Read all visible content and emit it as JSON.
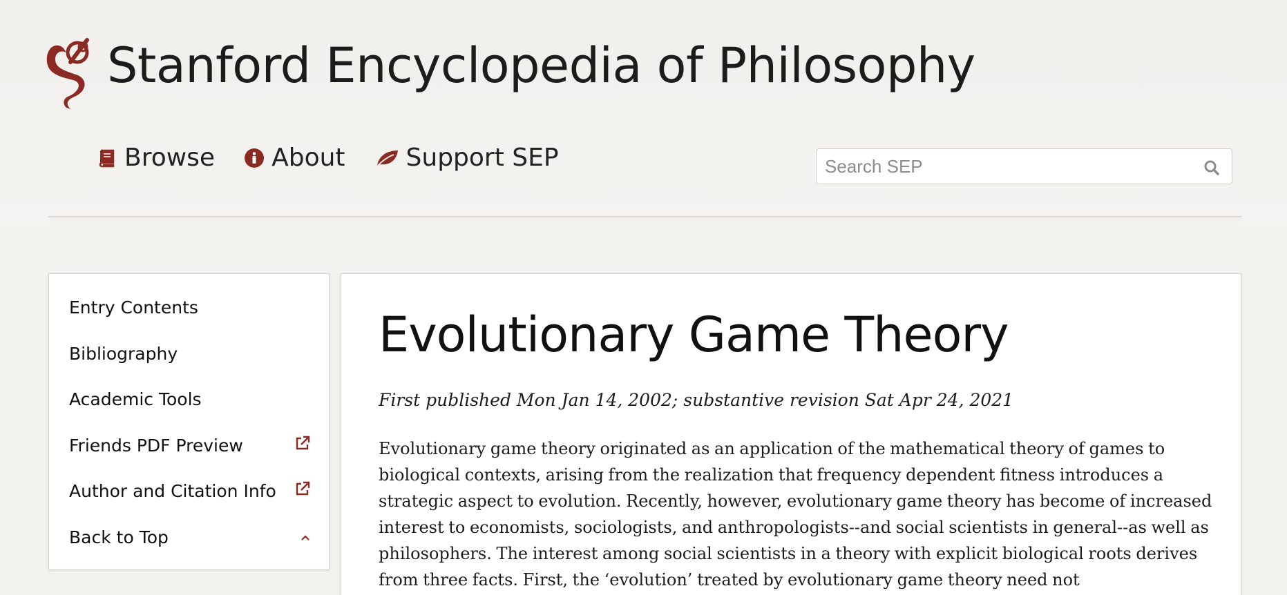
{
  "site": {
    "title": "Stanford Encyclopedia of Philosophy",
    "logo_icon": "sep-logo-icon"
  },
  "nav": {
    "items": [
      {
        "label": "Browse",
        "icon": "book-icon"
      },
      {
        "label": "About",
        "icon": "info-circle-icon"
      },
      {
        "label": "Support SEP",
        "icon": "leaf-icon"
      }
    ]
  },
  "search": {
    "placeholder": "Search SEP",
    "value": "",
    "icon": "search-icon"
  },
  "sidebar": {
    "items": [
      {
        "label": "Entry Contents",
        "icon": null
      },
      {
        "label": "Bibliography",
        "icon": null
      },
      {
        "label": "Academic Tools",
        "icon": null
      },
      {
        "label": "Friends PDF Preview",
        "icon": "external-link-icon"
      },
      {
        "label": "Author and Citation Info",
        "icon": "external-link-icon"
      },
      {
        "label": "Back to Top",
        "icon": "chevron-up-icon"
      }
    ]
  },
  "entry": {
    "title": "Evolutionary Game Theory",
    "pubinfo": "First published Mon Jan 14, 2002; substantive revision Sat Apr 24, 2021",
    "preamble": "Evolutionary game theory originated as an application of the mathematical theory of games to biological contexts, arising from the realization that frequency dependent fitness introduces a strategic aspect to evolution. Recently, however, evolutionary game theory has become of increased interest to economists, sociologists, and anthropologists--and social scientists in general--as well as philosophers. The interest among social scientists in a theory with explicit biological roots derives from three facts. First, the ‘evolution’ treated by evolutionary game theory need not"
  },
  "colors": {
    "accent": "#8b2a22",
    "background": "#f3f1ee",
    "panel": "#ffffff",
    "text": "#1a1a1a"
  }
}
